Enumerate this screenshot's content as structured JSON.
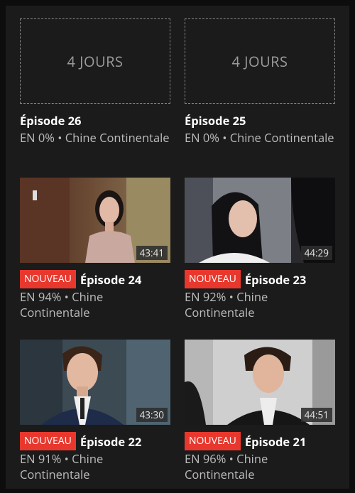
{
  "episodes": [
    {
      "placeholder": "4 JOURS",
      "title": "Épisode 26",
      "progress": "EN 0%",
      "dot": " • ",
      "region": "Chine Continentale",
      "badge": ""
    },
    {
      "placeholder": "4 JOURS",
      "title": "Épisode 25",
      "progress": "EN 0%",
      "dot": " • ",
      "region": "Chine Continentale",
      "badge": ""
    },
    {
      "duration": "43:41",
      "title": "Épisode 24",
      "progress": "EN 94%",
      "dot": " • ",
      "region": "Chine Continentale",
      "badge": "NOUVEAU"
    },
    {
      "duration": "44:29",
      "title": "Épisode 23",
      "progress": "EN 92%",
      "dot": " • ",
      "region": "Chine Continentale",
      "badge": "NOUVEAU"
    },
    {
      "duration": "43:30",
      "title": "Épisode 22",
      "progress": "EN 91%",
      "dot": " • ",
      "region": "Chine Continentale",
      "badge": "NOUVEAU"
    },
    {
      "duration": "44:51",
      "title": "Épisode 21",
      "progress": "EN 96%",
      "dot": " • ",
      "region": "Chine Continentale",
      "badge": "NOUVEAU"
    }
  ]
}
